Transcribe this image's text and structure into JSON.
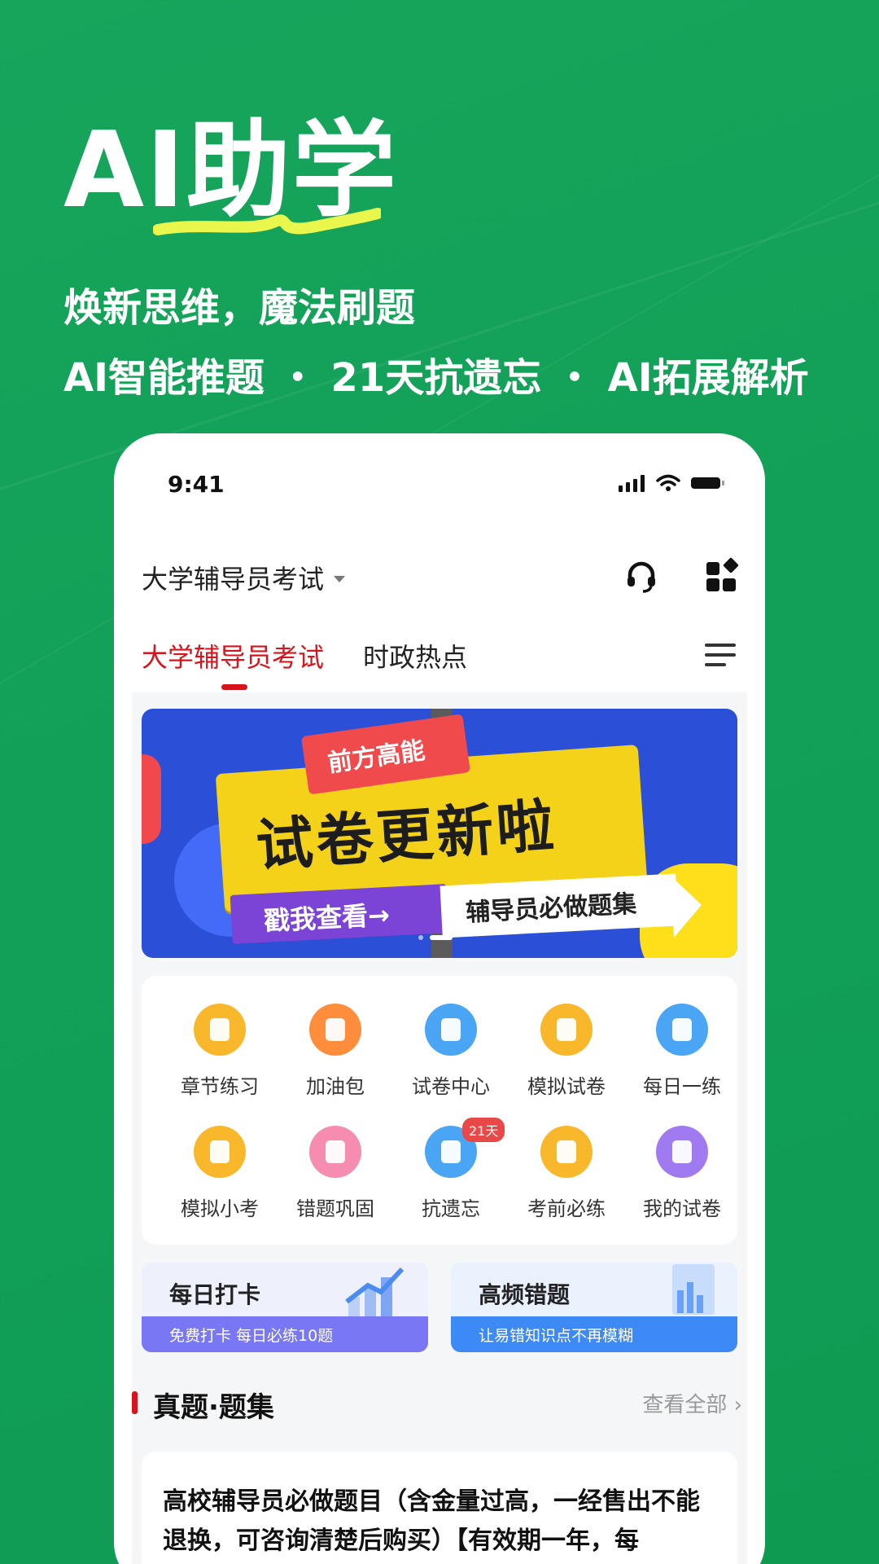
{
  "promo": {
    "headline": "AI助学",
    "tagline": "焕新思维，魔法刷题",
    "features": "AI智能推题 ・ 21天抗遗忘 ・ AI拓展解析"
  },
  "status_bar": {
    "time": "9:41"
  },
  "header": {
    "exam_selector": "大学辅导员考试",
    "icons": [
      "headset-icon",
      "apps-grid-icon"
    ]
  },
  "tabs": [
    {
      "label": "大学辅导员考试",
      "active": true
    },
    {
      "label": "时政热点",
      "active": false
    }
  ],
  "banner": {
    "tag": "前方高能",
    "headline": "试卷更新啦",
    "cta": "戳我查看→",
    "sub": "辅导员必做题集",
    "pages": 2,
    "current_page": 2
  },
  "grid": [
    {
      "label": "章节练习",
      "icon": "chapter-icon",
      "color": "#f9b82b"
    },
    {
      "label": "加油包",
      "icon": "gift-icon",
      "color": "#ff8d3b"
    },
    {
      "label": "试卷中心",
      "icon": "paper-icon",
      "color": "#4aa6f5"
    },
    {
      "label": "模拟试卷",
      "icon": "mock-paper-icon",
      "color": "#f9b82b"
    },
    {
      "label": "每日一练",
      "icon": "pencil-icon",
      "color": "#4aa6f5"
    },
    {
      "label": "模拟小考",
      "icon": "trophy-icon",
      "color": "#f9b82b"
    },
    {
      "label": "错题巩固",
      "icon": "wrong-icon",
      "color": "#f68db0"
    },
    {
      "label": "抗遗忘",
      "icon": "calendar-icon",
      "color": "#4aa6f5",
      "badge": "21天"
    },
    {
      "label": "考前必练",
      "icon": "chart-icon",
      "color": "#f9b82b"
    },
    {
      "label": "我的试卷",
      "icon": "my-paper-icon",
      "color": "#a07af0"
    }
  ],
  "cards": [
    {
      "title": "每日打卡",
      "subtitle": "免费打卡 每日必练10题",
      "bar_color": "#7a77f5",
      "bg": "#eef0fc"
    },
    {
      "title": "高频错题",
      "subtitle": "让易错知识点不再模糊",
      "bar_color": "#3d8af7",
      "bg": "#eaf2fe"
    }
  ],
  "section": {
    "title": "真题·题集",
    "more": "查看全部"
  },
  "question_set": {
    "title": "高校辅导员必做题目（含金量过高，一经售出不能退换，可咨询清楚后购买）【有效期一年，每"
  }
}
